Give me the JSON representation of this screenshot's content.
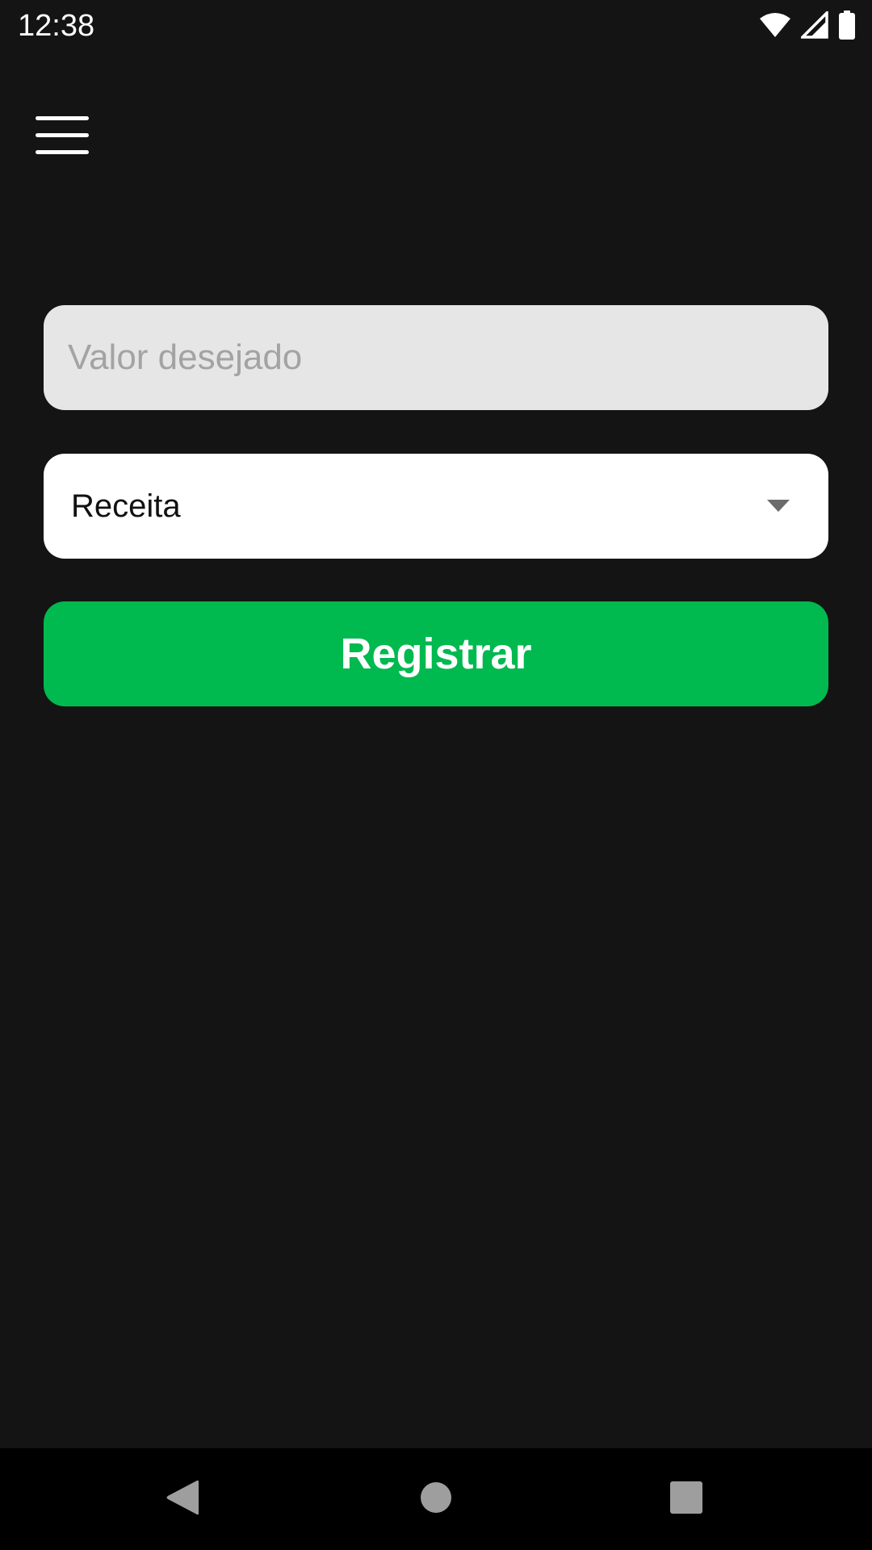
{
  "status_bar": {
    "time": "12:38",
    "icons": [
      "wifi-icon",
      "signal-icon",
      "battery-icon"
    ]
  },
  "toolbar": {
    "menu_icon": "hamburger-menu-icon"
  },
  "form": {
    "value_input": {
      "value": "",
      "placeholder": "Valor desejado"
    },
    "type_select": {
      "selected": "Receita"
    },
    "register_button": {
      "label": "Registrar"
    }
  },
  "nav_bar": {
    "icons": [
      "back-icon",
      "home-icon",
      "recents-icon"
    ]
  },
  "colors": {
    "background": "#141414",
    "input_background": "#e6e6e6",
    "select_background": "#ffffff",
    "accent_green": "#00b94f",
    "nav_bar": "#000000"
  }
}
